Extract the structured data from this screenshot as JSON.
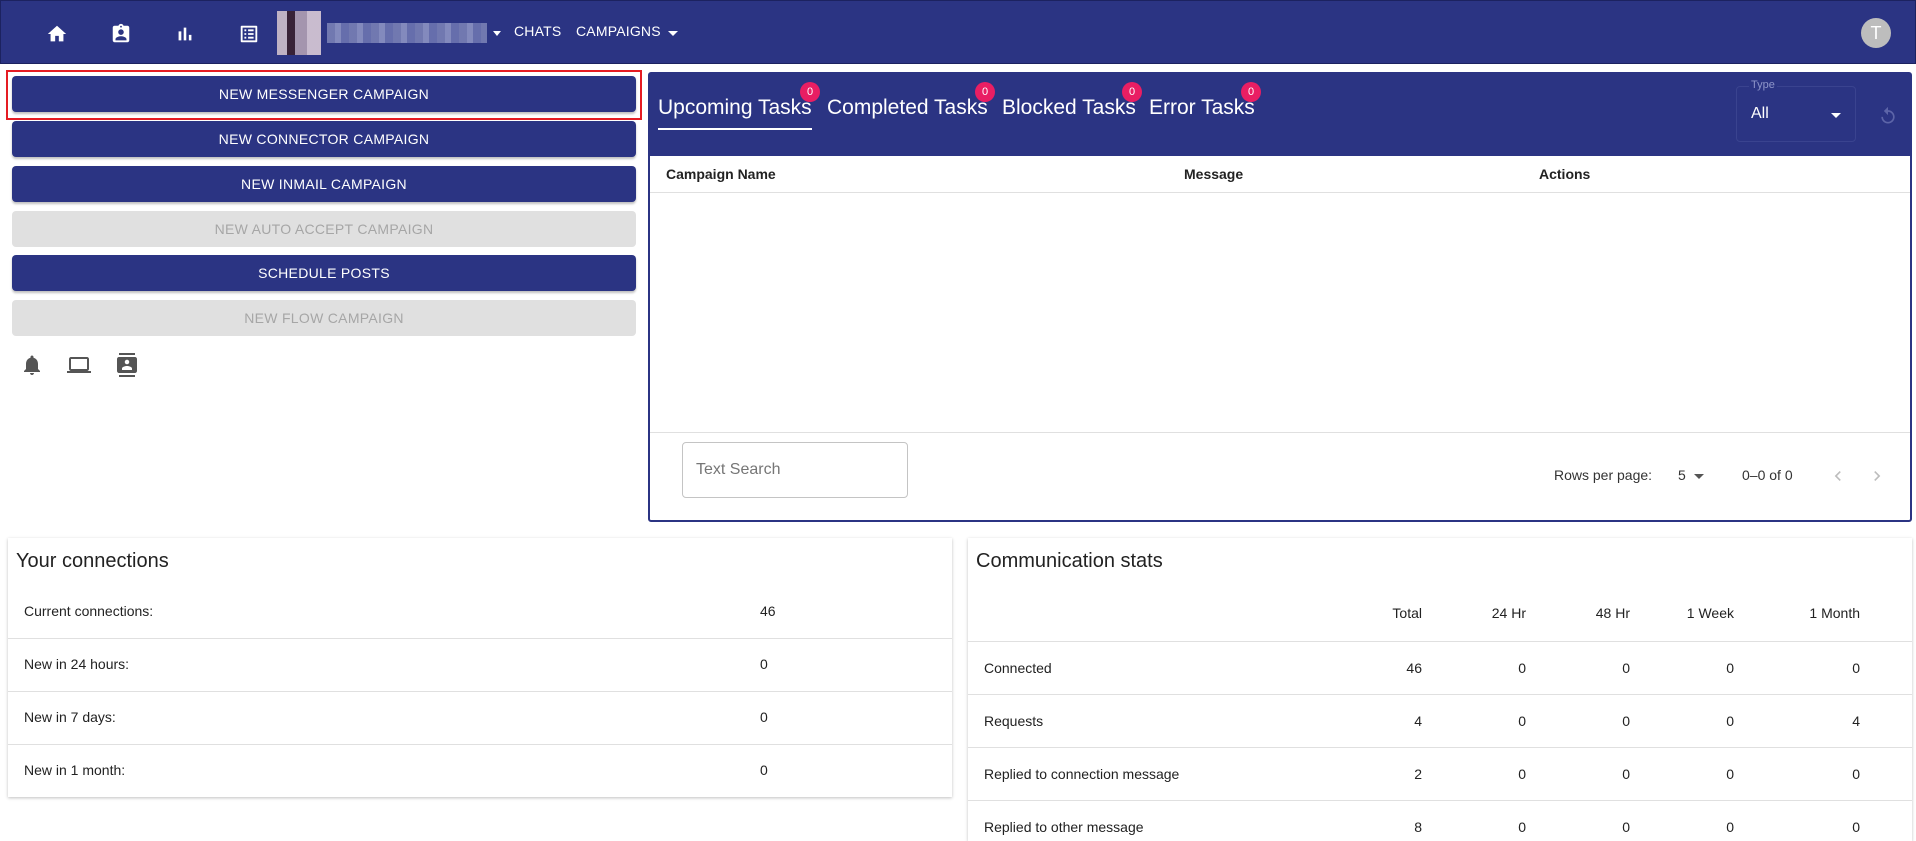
{
  "nav": {
    "icons": [
      "home-icon",
      "contact-badge-icon",
      "bar-chart-icon",
      "list-icon"
    ],
    "chats": "CHATS",
    "campaigns": "CAMPAIGNS",
    "avatar_initial": "T"
  },
  "campaign_buttons": [
    {
      "label": "NEW MESSENGER CAMPAIGN",
      "enabled": true
    },
    {
      "label": "NEW CONNECTOR CAMPAIGN",
      "enabled": true
    },
    {
      "label": "NEW INMAIL CAMPAIGN",
      "enabled": true
    },
    {
      "label": "NEW AUTO ACCEPT CAMPAIGN",
      "enabled": false
    },
    {
      "label": "SCHEDULE POSTS",
      "enabled": true
    },
    {
      "label": "NEW FLOW CAMPAIGN",
      "enabled": false
    }
  ],
  "quick_icons": [
    "bell-icon",
    "laptop-icon",
    "contact-card-icon"
  ],
  "tasks": {
    "tabs": [
      {
        "label": "Upcoming Tasks",
        "count": "0"
      },
      {
        "label": "Completed Tasks",
        "count": "0"
      },
      {
        "label": "Blocked Tasks",
        "count": "0"
      },
      {
        "label": "Error Tasks",
        "count": "0"
      }
    ],
    "type_filter": {
      "label": "Type",
      "value": "All"
    },
    "columns": [
      "Campaign Name",
      "Message",
      "Actions"
    ],
    "search_placeholder": "Text Search",
    "rows_per_page_label": "Rows per page:",
    "rows_per_page": "5",
    "range": "0–0 of 0"
  },
  "connections": {
    "title": "Your connections",
    "rows": [
      {
        "label": "Current connections:",
        "value": "46"
      },
      {
        "label": "New in 24 hours:",
        "value": "0"
      },
      {
        "label": "New in 7 days:",
        "value": "0"
      },
      {
        "label": "New in 1 month:",
        "value": "0"
      }
    ]
  },
  "stats": {
    "title": "Communication stats",
    "columns": [
      "Total",
      "24 Hr",
      "48 Hr",
      "1 Week",
      "1 Month"
    ],
    "rows": [
      {
        "label": "Connected",
        "values": [
          "46",
          "0",
          "0",
          "0",
          "0"
        ]
      },
      {
        "label": "Requests",
        "values": [
          "4",
          "0",
          "0",
          "0",
          "4"
        ]
      },
      {
        "label": "Replied to connection message",
        "values": [
          "2",
          "0",
          "0",
          "0",
          "0"
        ]
      },
      {
        "label": "Replied to other message",
        "values": [
          "8",
          "0",
          "0",
          "0",
          "0"
        ]
      }
    ]
  },
  "colors": {
    "primary": "#2b3483",
    "badge": "#e91e63",
    "highlight": "#e51c23"
  }
}
